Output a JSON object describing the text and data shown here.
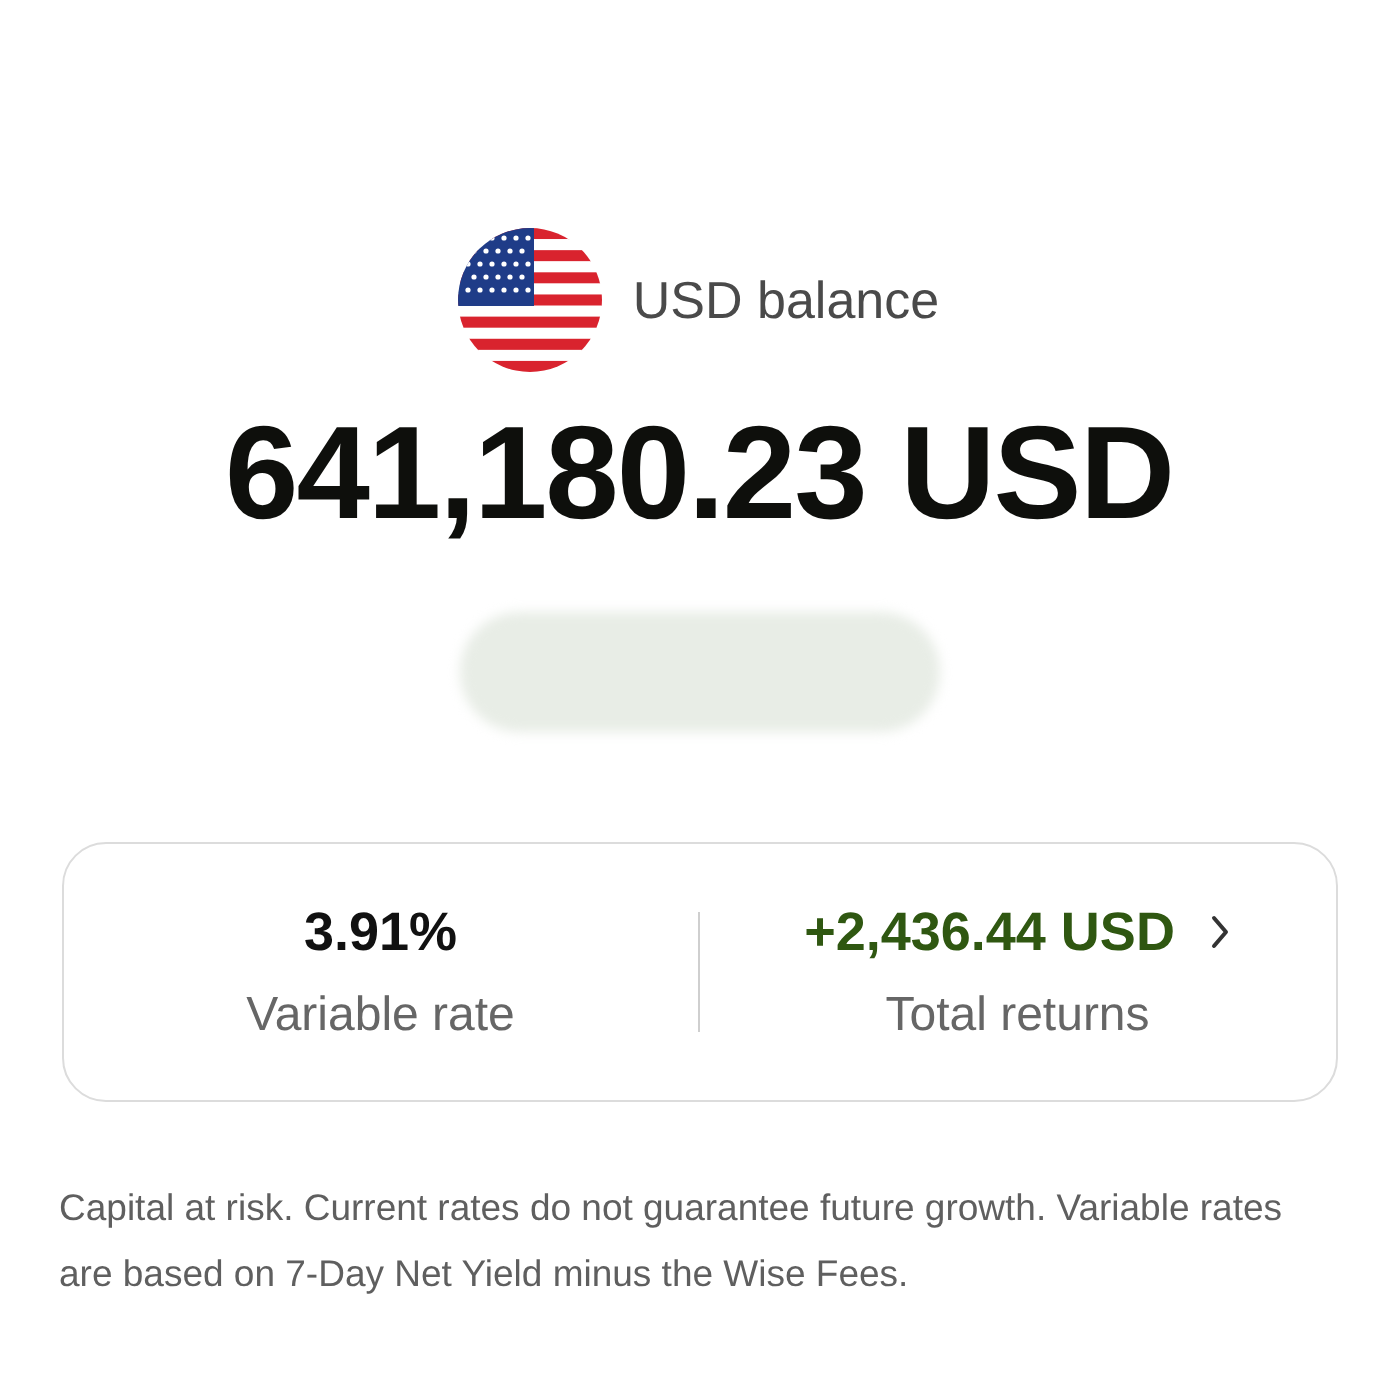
{
  "balance": {
    "label": "USD balance",
    "amount": "641,180.23 USD"
  },
  "stats": [
    {
      "kind": "plain",
      "value": "3.91%",
      "label": "Variable rate"
    },
    {
      "kind": "link",
      "value": "+2,436.44 USD",
      "label": "Total returns"
    }
  ],
  "disclaimer": "Capital at risk. Current rates do not guarantee future growth. Variable rates are based on 7-Day Net Yield minus the Wise Fees."
}
